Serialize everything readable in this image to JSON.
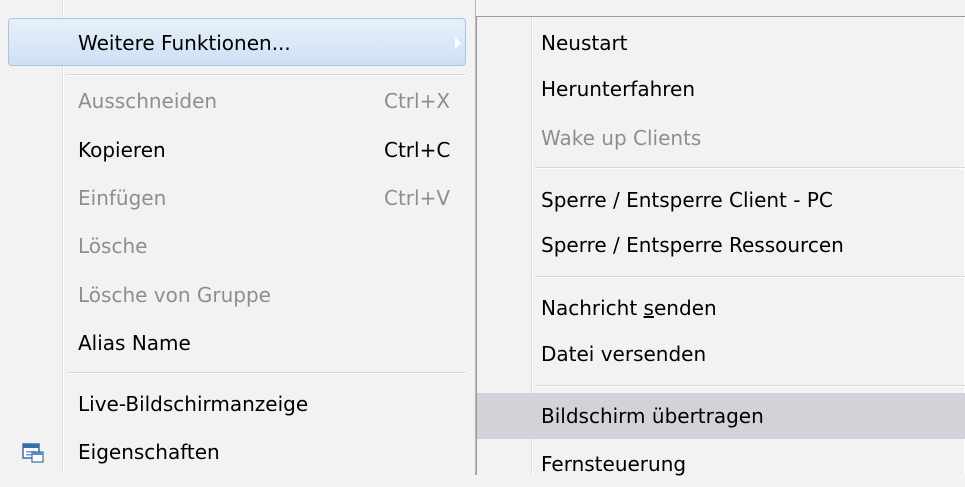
{
  "main_menu": {
    "more_functions": "Weitere Funktionen...",
    "cut": "Ausschneiden",
    "cut_shortcut": "Ctrl+X",
    "copy": "Kopieren",
    "copy_shortcut": "Ctrl+C",
    "paste": "Einfügen",
    "paste_shortcut": "Ctrl+V",
    "delete": "Lösche",
    "delete_from_group": "Lösche von Gruppe",
    "alias_name": "Alias Name",
    "live_screen": "Live-Bildschirmanzeige",
    "properties": "Eigenschaften"
  },
  "submenu": {
    "restart": "Neustart",
    "shutdown": "Herunterfahren",
    "wake_up": "Wake up Clients",
    "lock_client": "Sperre / Entsperre Client - PC",
    "lock_resources": "Sperre / Entsperre Ressourcen",
    "send_message_pre": "Nachricht ",
    "send_message_ul": "s",
    "send_message_post": "enden",
    "send_file": "Datei versenden",
    "transfer_screen": "Bildschirm übertragen",
    "remote_control": "Fernsteuerung"
  },
  "icons": {
    "submenu_arrow": "triangle-right",
    "properties": "properties-window-icon"
  },
  "colors": {
    "menu_bg": "#f2f2f2",
    "highlight_border": "#a9c4e3",
    "highlight_bg": "#dbe8f7",
    "hover_bg": "#d2d2d8",
    "disabled_text": "#8e8e8e"
  }
}
